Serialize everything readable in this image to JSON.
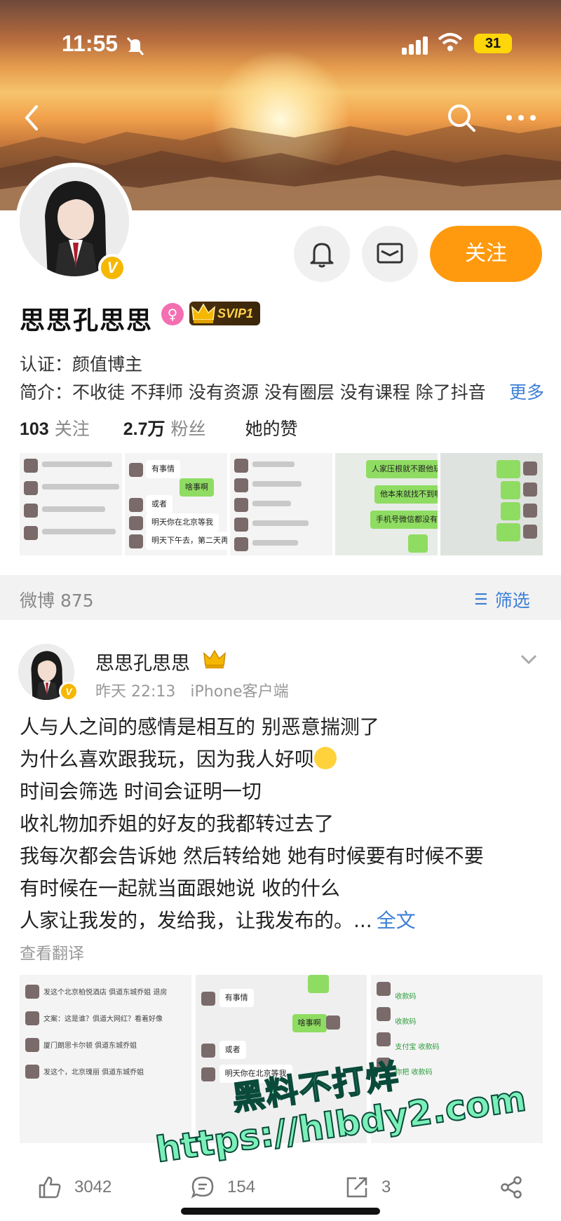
{
  "status_bar": {
    "time": "11:55",
    "battery": "31"
  },
  "profile": {
    "name": "思思孔思思",
    "svip_label": "SVIP1",
    "follow_label": "关注",
    "certification": "认证：颜值博主",
    "bio": "简介：不收徒 不拜师 没有资源 没有圈层 没有课程 除了抖音",
    "bio_more": "更多",
    "stats": {
      "following_count": "103",
      "following_label": "关注",
      "fans_count": "2.7万",
      "fans_label": "粉丝",
      "likes_label": "她的赞"
    }
  },
  "feed_bar": {
    "count_label": "微博 875",
    "filter_label": "筛选"
  },
  "post": {
    "author": "思思孔思思",
    "time": "昨天 22:13",
    "source": "iPhone客户端",
    "lines": [
      "人与人之间的感情是相互的 别恶意揣测了",
      "为什么喜欢跟我玩，因为我人好呗",
      "时间会筛选 时间会证明一切",
      "收礼物加乔姐的好友的我都转过去了",
      "我每次都会告诉她 然后转给她 她有时候要有时候不要",
      "有时候在一起就当面跟她说 收的什么",
      "人家让我发的，发给我，让我发布的。..."
    ],
    "full_text_label": "全文",
    "translate_label": "查看翻译",
    "watermark_line1": "黑料不打烊",
    "watermark_line2": "https://hlbdy2.com",
    "likes": "3042",
    "comments": "154",
    "reposts": "3"
  },
  "album_chat_text": {
    "b1": "有事情",
    "b2": "啥事啊",
    "b3": "或者",
    "b4": "明天你在北京等我",
    "b5": "明天下午去，第二天再回来",
    "g1": "人家压根就不跟他玩",
    "g2": "他本来就找不到啊",
    "g3": "手机号微信都没有"
  },
  "post_chat_text": {
    "a1": "发这个北京柏悦酒店 俱道东城乔姐 退房",
    "a2": "文案：这是谁？俱道大网红？看着好像",
    "a3": "厦门朗思卡尔顿 俱道东城乔姐",
    "a4": "发这个，北京瑰丽 俱道东城乔姐",
    "b1": "有事情",
    "b2": "啥事啊",
    "b3": "或者",
    "b4": "明天你在北京等我",
    "c1": "收款码",
    "c2": "收款码",
    "c3": "支付宝 收款码",
    "c4": "你把 收款码"
  },
  "colors": {
    "accent": "#ff9a0e",
    "link": "#3d7fd6",
    "vip_gold": "#f5b700"
  }
}
